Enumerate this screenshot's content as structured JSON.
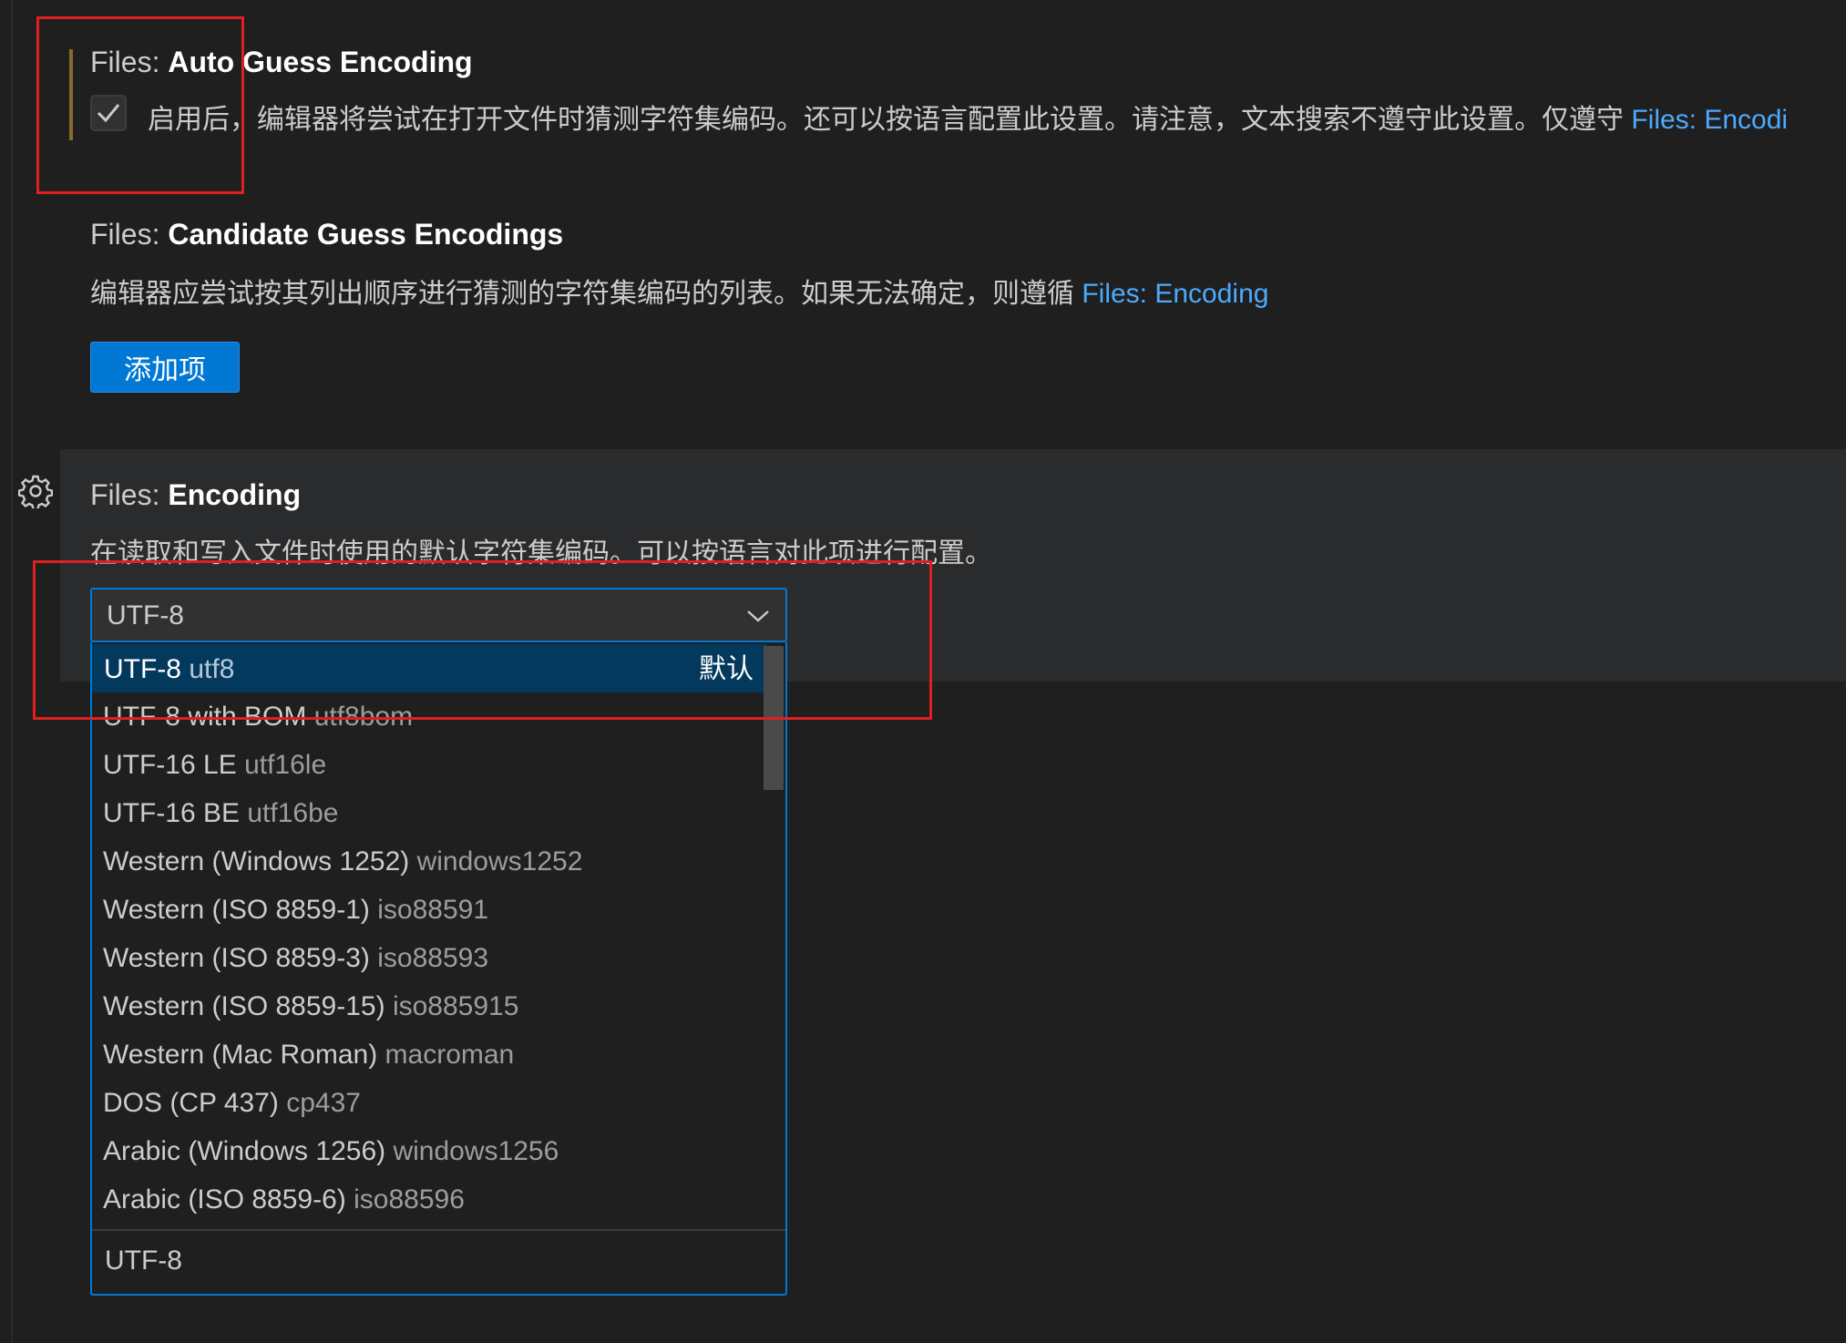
{
  "auto_guess": {
    "category": "Files: ",
    "title": "Auto Guess Encoding",
    "checked": true,
    "description": "启用后，编辑器将尝试在打开文件时猜测字符集编码。还可以按语言配置此设置。请注意，文本搜索不遵守此设置。仅遵守 ",
    "link": "Files: Encodi"
  },
  "candidate": {
    "category": "Files: ",
    "title": "Candidate Guess Encodings",
    "description": "编辑器应尝试按其列出顺序进行猜测的字符集编码的列表。如果无法确定，则遵循 ",
    "link": "Files: Encoding",
    "add_button": "添加项"
  },
  "encoding": {
    "category": "Files: ",
    "title": "Encoding",
    "description": "在读取和写入文件时使用的默认字符集编码。可以按语言对此项进行配置。",
    "value": "UTF-8",
    "gear_icon": "gear-icon",
    "chevron_icon": "chevron-down-icon",
    "options": [
      {
        "label": "UTF-8",
        "id": "utf8",
        "tag": "默认"
      },
      {
        "label": "UTF-8 with BOM",
        "id": "utf8bom"
      },
      {
        "label": "UTF-16 LE",
        "id": "utf16le"
      },
      {
        "label": "UTF-16 BE",
        "id": "utf16be"
      },
      {
        "label": "Western (Windows 1252)",
        "id": "windows1252"
      },
      {
        "label": "Western (ISO 8859-1)",
        "id": "iso88591"
      },
      {
        "label": "Western (ISO 8859-3)",
        "id": "iso88593"
      },
      {
        "label": "Western (ISO 8859-15)",
        "id": "iso885915"
      },
      {
        "label": "Western (Mac Roman)",
        "id": "macroman"
      },
      {
        "label": "DOS (CP 437)",
        "id": "cp437"
      },
      {
        "label": "Arabic (Windows 1256)",
        "id": "windows1256"
      },
      {
        "label": "Arabic (ISO 8859-6)",
        "id": "iso88596"
      }
    ],
    "footer": "UTF-8"
  },
  "colors": {
    "accent": "#0078d4",
    "link": "#4daafc",
    "annotation": "#e02020",
    "selected_option": "#04395e"
  }
}
